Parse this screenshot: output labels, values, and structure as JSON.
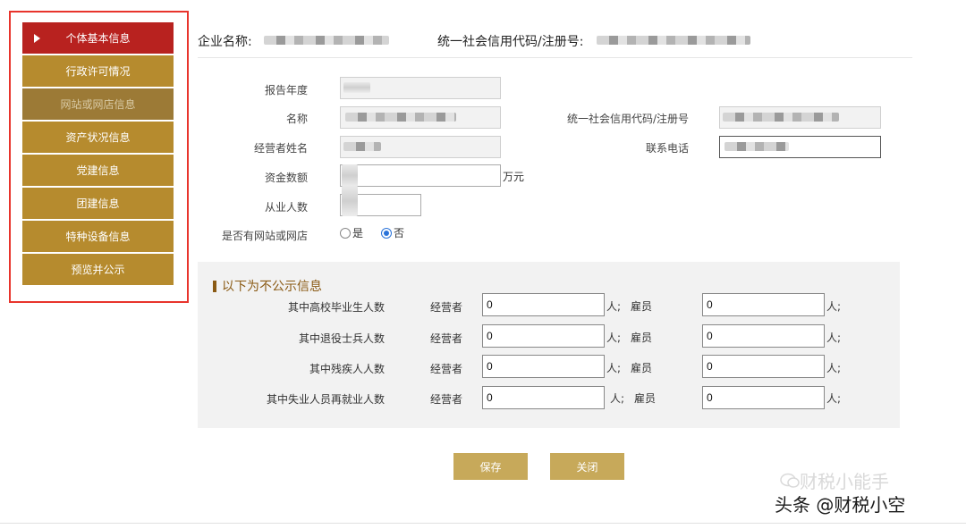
{
  "sidebar": {
    "items": [
      {
        "label": "个体基本信息",
        "state": "active"
      },
      {
        "label": "行政许可情况",
        "state": "normal"
      },
      {
        "label": "网站或网店信息",
        "state": "disabled"
      },
      {
        "label": "资产状况信息",
        "state": "normal"
      },
      {
        "label": "党建信息",
        "state": "normal"
      },
      {
        "label": "团建信息",
        "state": "normal"
      },
      {
        "label": "特种设备信息",
        "state": "normal"
      },
      {
        "label": "预览并公示",
        "state": "normal"
      }
    ]
  },
  "header": {
    "company_label": "企业名称:",
    "credit_label": "统一社会信用代码/注册号:"
  },
  "form": {
    "report_year_label": "报告年度",
    "name_label": "名称",
    "credit_code_label": "统一社会信用代码/注册号",
    "operator_label": "经营者姓名",
    "phone_label": "联系电话",
    "funds_label": "资金数额",
    "funds_unit": "万元",
    "employees_label": "从业人数",
    "has_website_label": "是否有网站或网店",
    "radio_yes": "是",
    "radio_no": "否",
    "has_website_value": "否"
  },
  "nonpublic": {
    "title": "以下为不公示信息",
    "operator_label": "经营者",
    "employee_label": "雇员",
    "unit_person_operator": "人;",
    "unit_person_employee": "人;",
    "rows": [
      {
        "label": "其中高校毕业生人数",
        "operator": "0",
        "employee": "0"
      },
      {
        "label": "其中退役士兵人数",
        "operator": "0",
        "employee": "0"
      },
      {
        "label": "其中残疾人人数",
        "operator": "0",
        "employee": "0"
      },
      {
        "label": "其中失业人员再就业人数",
        "operator": "0",
        "employee": "0"
      }
    ]
  },
  "buttons": {
    "save": "保存",
    "close": "关闭"
  },
  "watermark": {
    "line1": "财税小能手",
    "line2": "头条 @财税小空"
  }
}
